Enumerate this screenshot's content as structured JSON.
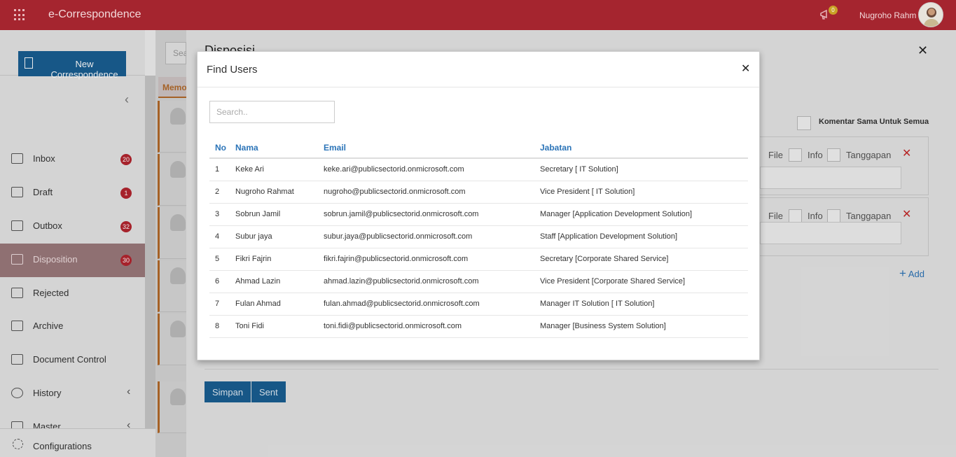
{
  "app": {
    "title": "e-Correspondence"
  },
  "header": {
    "user_name": "Nugroho Rahm",
    "notification_count": "0"
  },
  "sidebar": {
    "new_button": "New Correspondence",
    "items": [
      {
        "label": "Inbox",
        "badge": "20",
        "icon": "inbox-icon"
      },
      {
        "label": "Draft",
        "badge": "1",
        "icon": "draft-icon"
      },
      {
        "label": "Outbox",
        "badge": "32",
        "icon": "outbox-icon"
      },
      {
        "label": "Disposition",
        "badge": "30",
        "icon": "disposition-icon"
      },
      {
        "label": "Rejected",
        "icon": "rejected-icon"
      },
      {
        "label": "Archive",
        "icon": "archive-icon"
      },
      {
        "label": "Document Control",
        "icon": "document-control-icon"
      },
      {
        "label": "History",
        "icon": "history-icon"
      },
      {
        "label": "Master",
        "icon": "master-icon"
      },
      {
        "label": "Configurations",
        "icon": "gear-icon"
      }
    ]
  },
  "list": {
    "search_placeholder": "Sea",
    "tab": "Memo"
  },
  "panel": {
    "title": "Disposisi",
    "komentar_label": "Komentar Sama Untuk Semua",
    "row_labels": {
      "file": "File",
      "info": "Info",
      "tanggapan": "Tanggapan"
    },
    "add_label": "Add",
    "simpan_label": "Simpan",
    "sent_label": "Sent"
  },
  "modal": {
    "title": "Find Users",
    "search_placeholder": "Search..",
    "columns": {
      "no": "No",
      "nama": "Nama",
      "email": "Email",
      "jabatan": "Jabatan"
    },
    "rows": [
      {
        "no": "1",
        "nama": "Keke Ari",
        "email": "keke.ari@publicsectorid.onmicrosoft.com",
        "jabatan": "Secretary [ IT Solution]"
      },
      {
        "no": "2",
        "nama": "Nugroho Rahmat",
        "email": "nugroho@publicsectorid.onmicrosoft.com",
        "jabatan": "Vice President [ IT Solution]"
      },
      {
        "no": "3",
        "nama": "Sobrun Jamil",
        "email": "sobrun.jamil@publicsectorid.onmicrosoft.com",
        "jabatan": "Manager [Application Development Solution]"
      },
      {
        "no": "4",
        "nama": "Subur jaya",
        "email": "subur.jaya@publicsectorid.onmicrosoft.com",
        "jabatan": "Staff [Application Development Solution]"
      },
      {
        "no": "5",
        "nama": "Fikri Fajrin",
        "email": "fikri.fajrin@publicsectorid.onmicrosoft.com",
        "jabatan": "Secretary [Corporate Shared Service]"
      },
      {
        "no": "6",
        "nama": "Ahmad Lazin",
        "email": "ahmad.lazin@publicsectorid.onmicrosoft.com",
        "jabatan": "Vice President [Corporate Shared Service]"
      },
      {
        "no": "7",
        "nama": "Fulan Ahmad",
        "email": "fulan.ahmad@publicsectorid.onmicrosoft.com",
        "jabatan": "Manager IT Solution [ IT Solution]"
      },
      {
        "no": "8",
        "nama": "Toni Fidi",
        "email": "toni.fidi@publicsectorid.onmicrosoft.com",
        "jabatan": "Manager [Business System Solution]"
      }
    ]
  },
  "colors": {
    "brand": "#a5252f",
    "primary": "#1a5f93",
    "link": "#2b74b8",
    "danger": "#c62828"
  }
}
